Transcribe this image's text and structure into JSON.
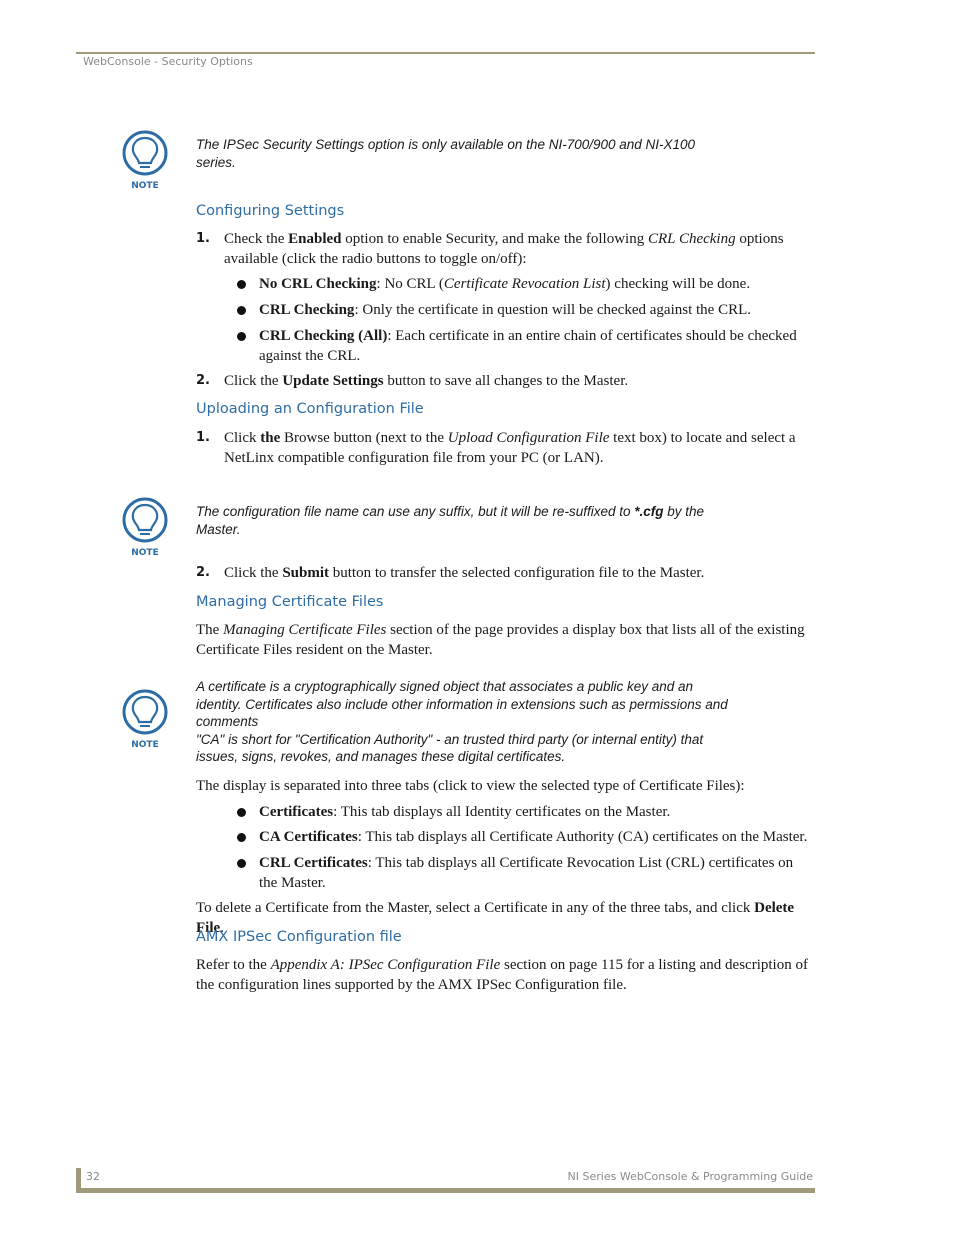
{
  "header": {
    "title": "WebConsole - Security Options"
  },
  "notes": [
    {
      "label": "NOTE",
      "text": "The IPSec Security Settings option is only available on the NI-700/900 and NI-X100 series."
    },
    {
      "label": "NOTE",
      "text_before": "The configuration file name can use any suffix, but it will be re-suffixed to ",
      "text_bold": "*.cfg",
      "text_after": " by the Master."
    },
    {
      "label": "NOTE",
      "line1": "A certificate is a cryptographically signed object that associates a public key and an identity. Certificates also include other information in extensions such as permissions and comments",
      "line2": "\"CA\" is short for \"Certification Authority\" - an trusted third party (or internal entity) that issues, signs, revokes, and manages these digital certificates."
    }
  ],
  "sections": {
    "configuring": {
      "heading": "Configuring Settings",
      "step1": {
        "num": "1.",
        "a": "Check the ",
        "b": "Enabled",
        "c": " option to enable Security, and make the following ",
        "d": "CRL Checking",
        "e": " options available (click the radio buttons to toggle on/off):"
      },
      "bullets": [
        {
          "bold": "No CRL Checking",
          "a": ": No CRL (",
          "i": "Certificate Revocation List",
          "b": ") checking will be done."
        },
        {
          "bold": "CRL Checking",
          "a": ": Only the certificate in question will be checked against the CRL."
        },
        {
          "bold": "CRL Checking (All)",
          "a": ": Each certificate in an entire chain of certificates should be checked against the CRL."
        }
      ],
      "step2": {
        "num": "2.",
        "a": "Click the ",
        "b": "Update Settings",
        "c": " button to save all changes to the Master."
      }
    },
    "uploading": {
      "heading": "Uploading an Configuration File",
      "step1": {
        "num": "1.",
        "a": "Click ",
        "b": "the",
        "c": " Browse button (next to the ",
        "d": "Upload Configuration File",
        "e": " text box) to locate and select a NetLinx compatible configuration file from your PC (or LAN)."
      },
      "step2": {
        "num": "2.",
        "a": "Click the ",
        "b": "Submit",
        "c": " button to transfer the selected configuration file to the Master."
      }
    },
    "managing": {
      "heading": "Managing Certificate Files",
      "intro": {
        "a": "The ",
        "i": "Managing Certificate Files",
        "b": " section of the page provides a display box that lists all of the existing Certificate Files resident on the Master."
      },
      "tabs_intro": "The display is separated into three tabs (click to view the selected type of Certificate Files):",
      "bullets": [
        {
          "bold": "Certificates",
          "a": ": This tab displays all Identity certificates on the Master."
        },
        {
          "bold": "CA Certificates",
          "a": ": This tab displays all Certificate Authority (CA) certificates on the Master."
        },
        {
          "bold": "CRL Certificates",
          "a": ": This tab displays all Certificate Revocation List (CRL) certificates on the Master."
        }
      ],
      "delete": {
        "a": "To delete a Certificate from the Master, select a Certificate in any of the three tabs, and click ",
        "b": "Delete File",
        "c": "."
      }
    },
    "amx": {
      "heading": "AMX IPSec Configuration file",
      "text": {
        "a": "Refer to the ",
        "i": "Appendix A: IPSec Configuration File",
        "b": " section on page 115 for a listing and description of the configuration lines supported by the AMX IPSec Configuration file."
      }
    }
  },
  "footer": {
    "page": "32",
    "title": "NI Series WebConsole & Programming Guide"
  },
  "colors": {
    "heading": "#2e6da4",
    "rule": "#a09a7c",
    "note_icon": "#2e6da4"
  }
}
